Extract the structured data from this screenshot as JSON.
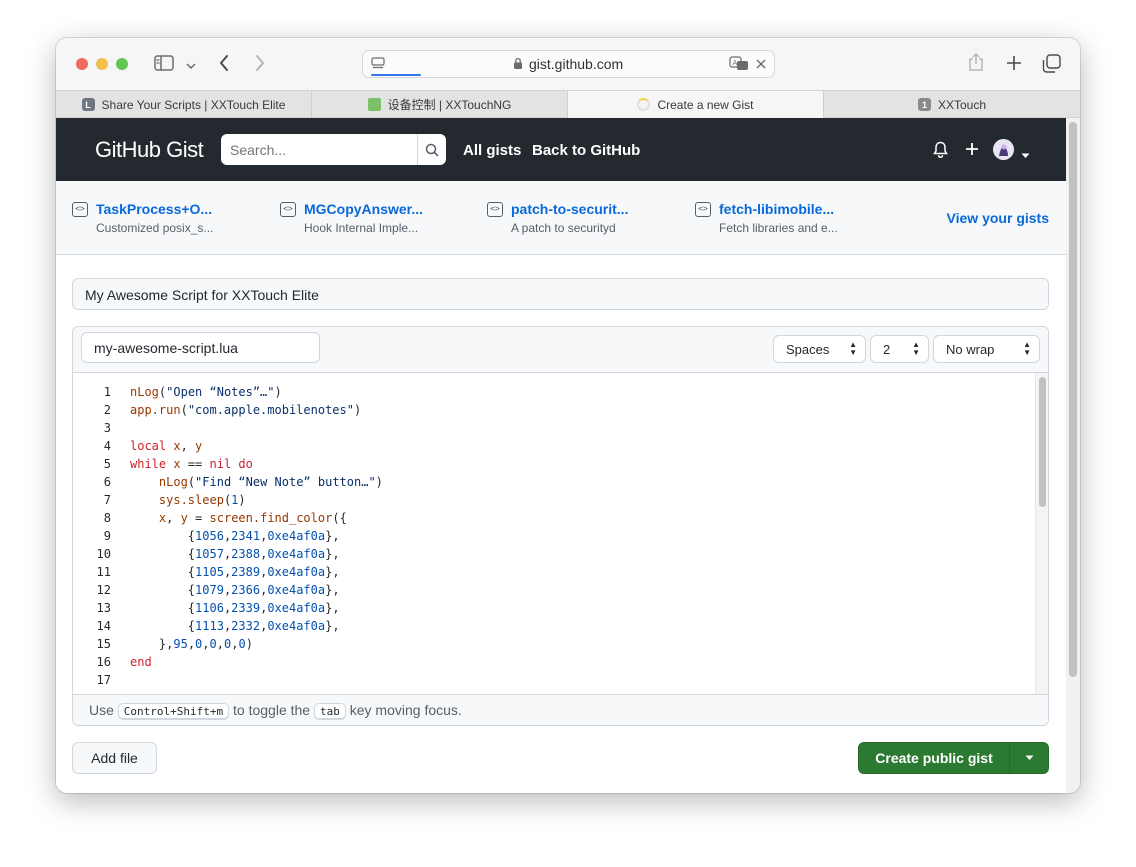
{
  "browser": {
    "url": "gist.github.com",
    "tabs": [
      {
        "label": "Share Your Scripts | XXTouch Elite",
        "favicon": "L",
        "favicon_color": "#6e7681"
      },
      {
        "label": "设备控制 | XXTouchNG",
        "favicon": "",
        "favicon_color": "#7cc06a"
      },
      {
        "label": "Create a new Gist",
        "favicon": "",
        "favicon_color": "#e6e6e6"
      },
      {
        "label": "XXTouch",
        "favicon": "1",
        "favicon_color": "#8a8a8a"
      }
    ]
  },
  "header": {
    "logo_text": "GitHub Gist",
    "search_placeholder": "Search...",
    "nav": [
      "All gists",
      "Back to GitHub"
    ]
  },
  "pinned": {
    "items": [
      {
        "title": "TaskProcess+O...",
        "desc": "Customized posix_s..."
      },
      {
        "title": "MGCopyAnswer...",
        "desc": "Hook Internal Imple..."
      },
      {
        "title": "patch-to-securit...",
        "desc": "A patch to securityd"
      },
      {
        "title": "fetch-libimobile...",
        "desc": "Fetch libraries and e..."
      }
    ],
    "view_link": "View your gists"
  },
  "form": {
    "description": "My Awesome Script for XXTouch Elite",
    "filename": "my-awesome-script.lua",
    "indent_mode": "Spaces",
    "indent_size": "2",
    "wrap_mode": "No wrap"
  },
  "code": {
    "line_numbers": [
      "1",
      "2",
      "3",
      "4",
      "5",
      "6",
      "7",
      "8",
      "9",
      "10",
      "11",
      "12",
      "13",
      "14",
      "15",
      "16",
      "17"
    ]
  },
  "footer_hint": {
    "prefix": "Use",
    "shortcut": "Control+Shift+m",
    "middle": "to toggle the",
    "key": "tab",
    "suffix": "key moving focus."
  },
  "actions": {
    "add_file": "Add file",
    "create": "Create public gist"
  },
  "colors": {
    "header_bg": "#24292f",
    "link": "#0969da",
    "primary_button": "#2c7a32",
    "keyword": "#cf222e",
    "function": "#953800",
    "number": "#0550ae",
    "string": "#0a3069"
  }
}
